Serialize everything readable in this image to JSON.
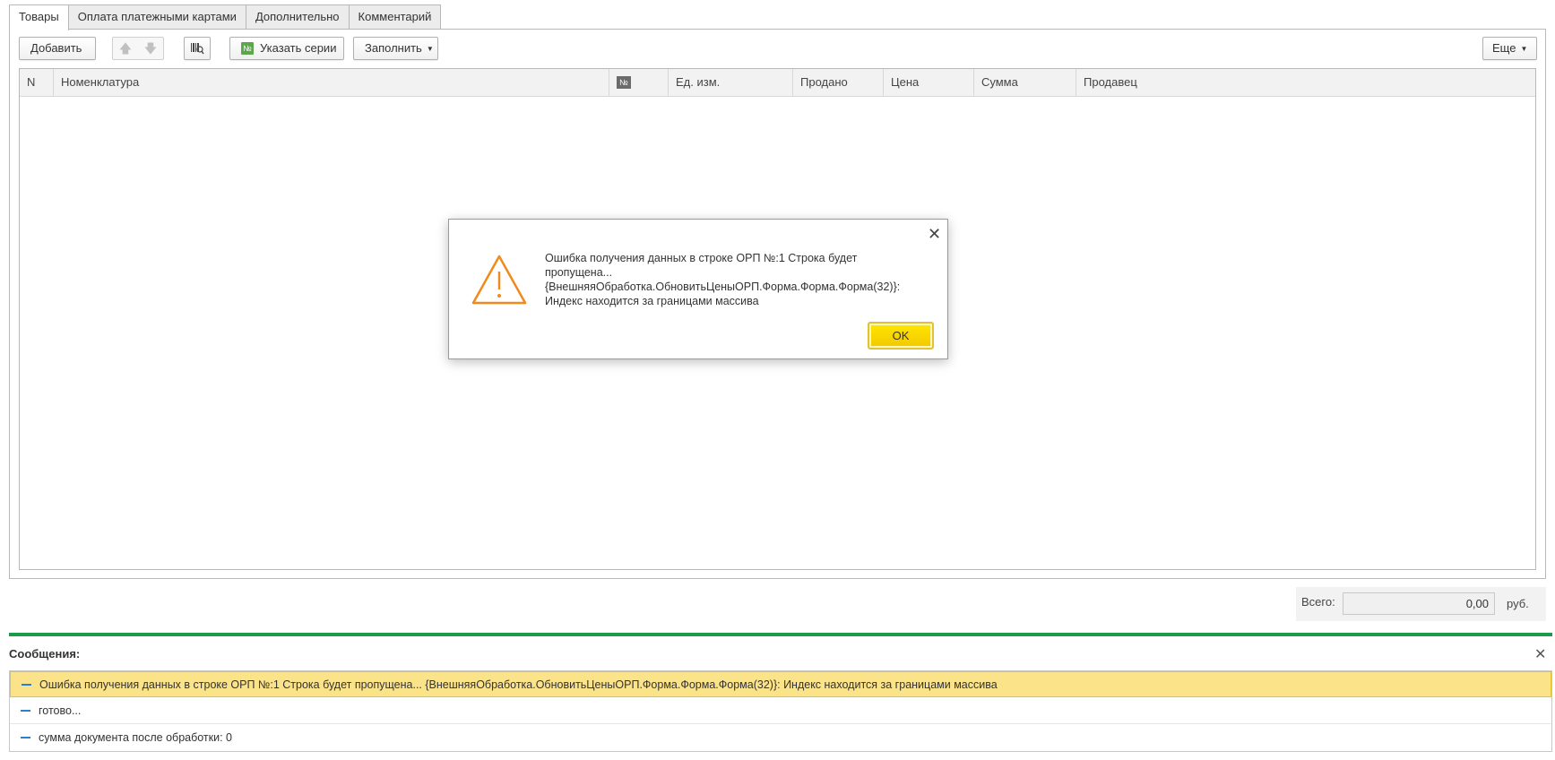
{
  "tabs": [
    "Товары",
    "Оплата платежными картами",
    "Дополнительно",
    "Комментарий"
  ],
  "toolbar": {
    "add": "Добавить",
    "series": "Указать серии",
    "series_icon_text": "№",
    "fill": "Заполнить",
    "more": "Еще"
  },
  "table": {
    "headers": [
      "N",
      "Номенклатура",
      "№",
      "Ед. изм.",
      "Продано",
      "Цена",
      "Сумма",
      "Продавец"
    ]
  },
  "total": {
    "label": "Всего:",
    "value": "0,00",
    "currency": "руб."
  },
  "messages": {
    "title": "Сообщения:",
    "items": [
      "Ошибка получения данных в строке ОРП №:1 Строка будет пропущена... {ВнешняяОбработка.ОбновитьЦеныОРП.Форма.Форма.Форма(32)}: Индекс находится за границами массива",
      "готово...",
      "сумма документа после обработки: 0"
    ]
  },
  "dialog": {
    "line1": "Ошибка получения данных в строке ОРП №:1 Строка будет",
    "line2": "пропущена...",
    "line3": "{ВнешняяОбработка.ОбновитьЦеныОРП.Форма.Форма.Форма(32)}:",
    "line4": "Индекс находится за границами массива",
    "ok": "OK"
  },
  "colors": {
    "accent_green": "#1a9a4a",
    "ok_yellow": "#ffe600",
    "selected_row": "#fbe38a",
    "warning_orange": "#f08a1c"
  }
}
